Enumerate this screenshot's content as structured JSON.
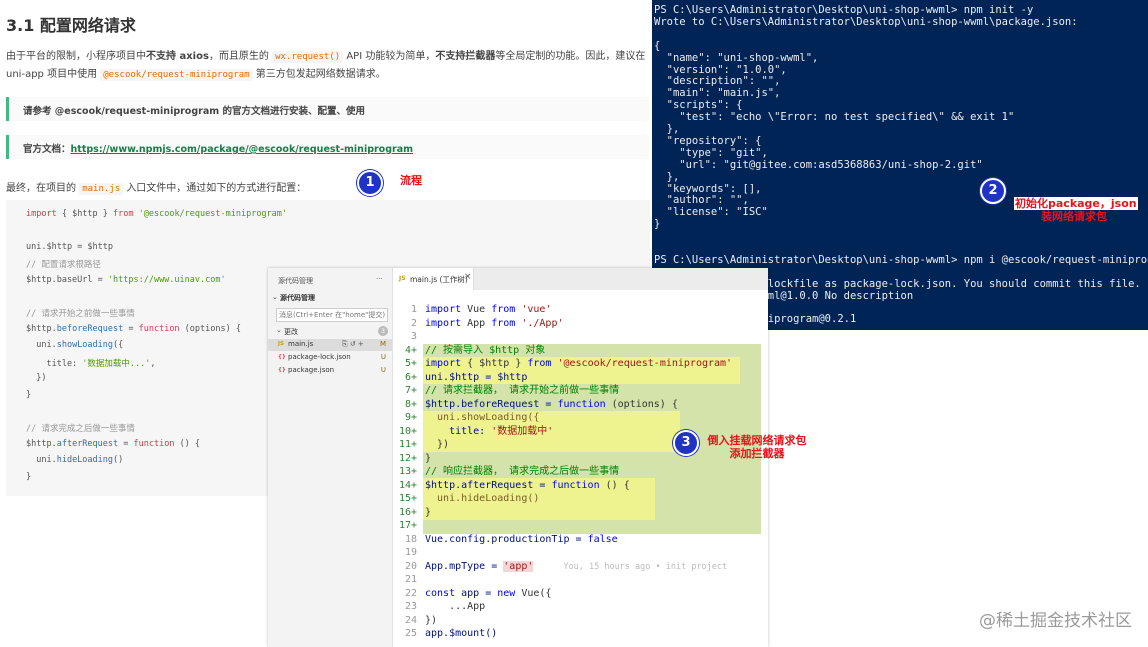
{
  "doc": {
    "title": "3.1 配置网络请求",
    "intro_line1": {
      "p1": "由于平台的限制，小程序项目中",
      "b1": "不支持 axios",
      "p2": "，而且原生的",
      "code1": "wx.request()",
      "p3": "API 功能较为简单，",
      "b2": "不支持拦截器",
      "p4": "等全局定制的功能。因此，建议在"
    },
    "intro_line2": {
      "p1": "uni-app 项目中使用",
      "code1": "@escook/request-miniprogram",
      "p2": "第三方包发起网络数据请求。"
    },
    "tip1": "请参考 @escook/request-miniprogram 的官方文档进行安装、配置、使用",
    "tip2_label": "官方文档：",
    "tip2_link": "https://www.npmjs.com/package/@escook/request-miniprogram",
    "final_line": {
      "p1": "最终，在项目的",
      "code1": "main.js",
      "p2": "入口文件中，通过如下的方式进行配置："
    },
    "code": {
      "l1_kw1": "import",
      "l1_mid": " { $http } ",
      "l1_kw2": "from",
      "l1_str": " '@escook/request-miniprogram'",
      "l2": "uni.$http = $http",
      "l3": "// 配置请求根路径",
      "l4_a": "$http.baseUrl = ",
      "l4_str": "'https://www.uinav.com'",
      "l5": "// 请求开始之前做一些事情",
      "l6_a": "$http.",
      "l6_fn": "beforeRequest",
      "l6_b": " = ",
      "l6_kw": "function",
      "l6_c": " (options) {",
      "l7_a": "  uni.",
      "l7_fn": "showLoading",
      "l7_b": "({",
      "l8_a": "    title: ",
      "l8_str": "'数据加载中...'",
      "l8_b": ",",
      "l9": "  })",
      "l10": "}",
      "l11": "// 请求完成之后做一些事情",
      "l12_a": "$http.",
      "l12_fn": "afterRequest",
      "l12_b": " = ",
      "l12_kw": "function",
      "l12_c": " () {",
      "l13_a": "  uni.",
      "l13_fn": "hideLoading",
      "l13_b": "()",
      "l14": "}"
    }
  },
  "annotations": {
    "badge1": "1",
    "label1": "流程",
    "badge2": "2",
    "label2_line1": "初始化package，json",
    "label2_line2": "装网络请求包",
    "badge3": "3",
    "label3_line1": "倒入挂载网络请求包",
    "label3_line2": "添加拦截器"
  },
  "terminal": {
    "lines": [
      "PS C:\\Users\\Administrator\\Desktop\\uni-shop-wwml> npm init -y",
      "Wrote to C:\\Users\\Administrator\\Desktop\\uni-shop-wwml\\package.json:",
      "",
      "{",
      "  \"name\": \"uni-shop-wwml\",",
      "  \"version\": \"1.0.0\",",
      "  \"description\": \"\",",
      "  \"main\": \"main.js\",",
      "  \"scripts\": {",
      "    \"test\": \"echo \\\"Error: no test specified\\\" && exit 1\"",
      "  },",
      "  \"repository\": {",
      "    \"type\": \"git\",",
      "    \"url\": \"git@gitee.com:asd5368863/uni-shop-2.git\"",
      "  },",
      "  \"keywords\": [],",
      "  \"author\": \"\",",
      "  \"license\": \"ISC\"",
      "}",
      "",
      "",
      "PS C:\\Users\\Administrator\\Desktop\\uni-shop-wwml> npm i @escook/request-miniprogram",
      "",
      "                a lockfile as package-lock.json. You should commit this file.",
      "                wwml@1.0.0 No description",
      "",
      "                iniprogram@0.2.1"
    ]
  },
  "vscode": {
    "scm_title": "源代码管理",
    "scm_more": "···",
    "scm_section": "源代码管理",
    "commit_placeholder": "消息(Ctrl+Enter 在\"home\"提交)",
    "changes_label": "更改",
    "changes_count": "3",
    "changed_files": [
      {
        "icon": "JS",
        "name": "main.js",
        "status": "M",
        "color": "#c5a000"
      },
      {
        "icon": "{}",
        "name": "package-lock.json",
        "status": "U",
        "color": "#c0504d"
      },
      {
        "icon": "{}",
        "name": "package.json",
        "status": "U",
        "color": "#c0504d"
      }
    ],
    "tab_icon": "JS",
    "tab_label": "main.js (工作树)",
    "tab_close": "×",
    "blame": "You, 15 hours ago • init project",
    "lines": {
      "n1": "1",
      "n2": "2",
      "n3": "3",
      "n4": "4+",
      "n5": "5+",
      "n6": "6+",
      "n7": "7+",
      "n8": "8+",
      "n9": "9+",
      "n10": "10+",
      "n11": "11+",
      "n12": "12+",
      "n13": "13+",
      "n14": "14+",
      "n15": "15+",
      "n16": "16+",
      "n17": "17+",
      "n18": "18",
      "n19": "19",
      "n20": "20",
      "n21": "21",
      "n22": "22",
      "n23": "23",
      "n24": "24",
      "n25": "25",
      "l1a": "import",
      "l1b": " Vue ",
      "l1c": "from",
      "l1d": " 'vue'",
      "l2a": "import",
      "l2b": " App ",
      "l2c": "from",
      "l2d": " './App'",
      "l4": "// 按需导入 $http 对象",
      "l5a": "import",
      "l5b": " { $http } ",
      "l5c": "from",
      "l5d": " '@escook/request-miniprogram'",
      "l6": "uni.$http = $http",
      "l7": "// 请求拦截器， 请求开始之前做一些事情",
      "l8a": "$http.beforeRequest = ",
      "l8b": "function",
      "l8c": " (options) {",
      "l9": "  uni.showLoading({",
      "l10a": "    title: ",
      "l10b": "'数据加载中'",
      "l11": "  })",
      "l12": "}",
      "l13": "// 响应拦截器， 请求完成之后做一些事情",
      "l14a": "$http.afterRequest = ",
      "l14b": "function",
      "l14c": " () {",
      "l15": "  uni.hideLoading()",
      "l16": "}",
      "l18a": "Vue.config.productionTip = ",
      "l18b": "false",
      "l20a": "App.mpType = ",
      "l20b": "'app'",
      "l22a": "const",
      "l22b": " app = ",
      "l22c": "new",
      "l22d": " Vue({",
      "l23": "    ...App",
      "l24": "})",
      "l25": "app.$mount()"
    }
  },
  "watermark": "@稀土掘金技术社区",
  "colors": {
    "terminal_bg": "#012456",
    "badge_blue": "#1f34c6",
    "callout_red": "#e4141b",
    "tip_border": "#42b983",
    "diff_green": "#d4e3a9",
    "diff_yellow": "#eef38f"
  }
}
